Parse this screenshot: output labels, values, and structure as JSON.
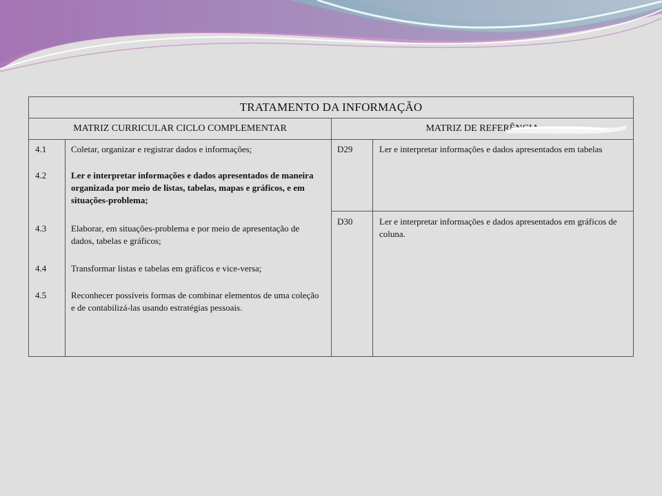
{
  "table": {
    "title": "TRATAMENTO DA INFORMAÇÃO",
    "left_header": "MATRIZ CURRICULAR CICLO COMPLEMENTAR",
    "right_header": "MATRIZ DE REFERÊNCIA",
    "curriculum": [
      {
        "code": "4.1",
        "text": "Coletar, organizar e registrar dados e informações;"
      },
      {
        "code": "4.2",
        "text": "Ler e interpretar informações e dados apresentados de maneira organizada por meio de listas, tabelas, mapas e gráficos, e em situações-problema;"
      },
      {
        "code": "4.3",
        "text": "Elaborar, em situações-problema e por meio de apresentação de dados, tabelas e gráficos;"
      },
      {
        "code": "4.4",
        "text": "Transformar listas e tabelas em gráficos e vice-versa;"
      },
      {
        "code": "4.5",
        "text": "Reconhecer possíveis formas de combinar elementos de uma coleção e de contabilizá-las usando estratégias pessoais."
      }
    ],
    "descriptors": [
      {
        "code": "D29",
        "text": "Ler e interpretar informações e dados apresentados em tabelas"
      },
      {
        "code": "D30",
        "text": "Ler e interpretar informações e dados apresentados em gráficos de coluna."
      }
    ]
  }
}
